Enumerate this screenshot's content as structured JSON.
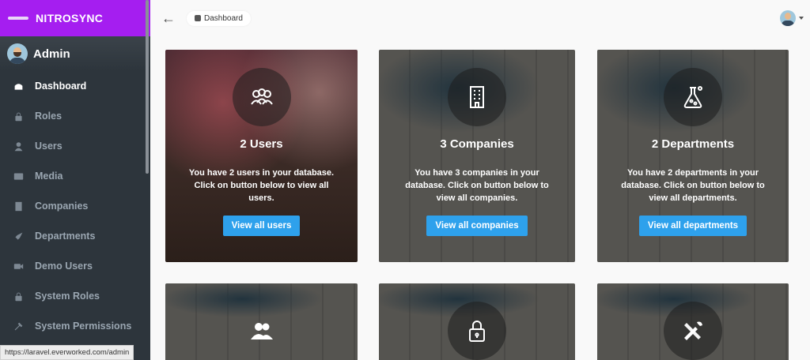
{
  "brand": {
    "name": "NITROSYNC"
  },
  "profile": {
    "name": "Admin"
  },
  "sidebar": {
    "items": [
      {
        "label": "Dashboard",
        "icon": "dashboard-icon",
        "active": true
      },
      {
        "label": "Roles",
        "icon": "lock-icon"
      },
      {
        "label": "Users",
        "icon": "user-icon"
      },
      {
        "label": "Media",
        "icon": "media-icon"
      },
      {
        "label": "Companies",
        "icon": "building-icon"
      },
      {
        "label": "Departments",
        "icon": "rocket-icon"
      },
      {
        "label": "Demo Users",
        "icon": "video-icon"
      },
      {
        "label": "System Roles",
        "icon": "lock-icon"
      },
      {
        "label": "System Permissions",
        "icon": "tools-icon"
      }
    ]
  },
  "topbar": {
    "back_icon": "arrow-left-icon",
    "breadcrumb": "Dashboard"
  },
  "cards": [
    {
      "title": "2 Users",
      "text": "You have 2 users in your database. Click on button below to view all users.",
      "button": "View all users",
      "icon": "users-icon"
    },
    {
      "title": "3 Companies",
      "text": "You have 3 companies in your database. Click on button below to view all companies.",
      "button": "View all companies",
      "icon": "building-icon"
    },
    {
      "title": "2 Departments",
      "text": "You have 2 departments in your database. Click on button below to view all departments.",
      "button": "View all departments",
      "icon": "flask-icon"
    },
    {
      "icon": "group-icon"
    },
    {
      "icon": "lock-icon"
    },
    {
      "icon": "tools-icon"
    }
  ],
  "status_url": "https://laravel.everworked.com/admin",
  "colors": {
    "brand": "#a51ef0",
    "sidebar": "#2d353c",
    "button": "#2ea1ec"
  }
}
